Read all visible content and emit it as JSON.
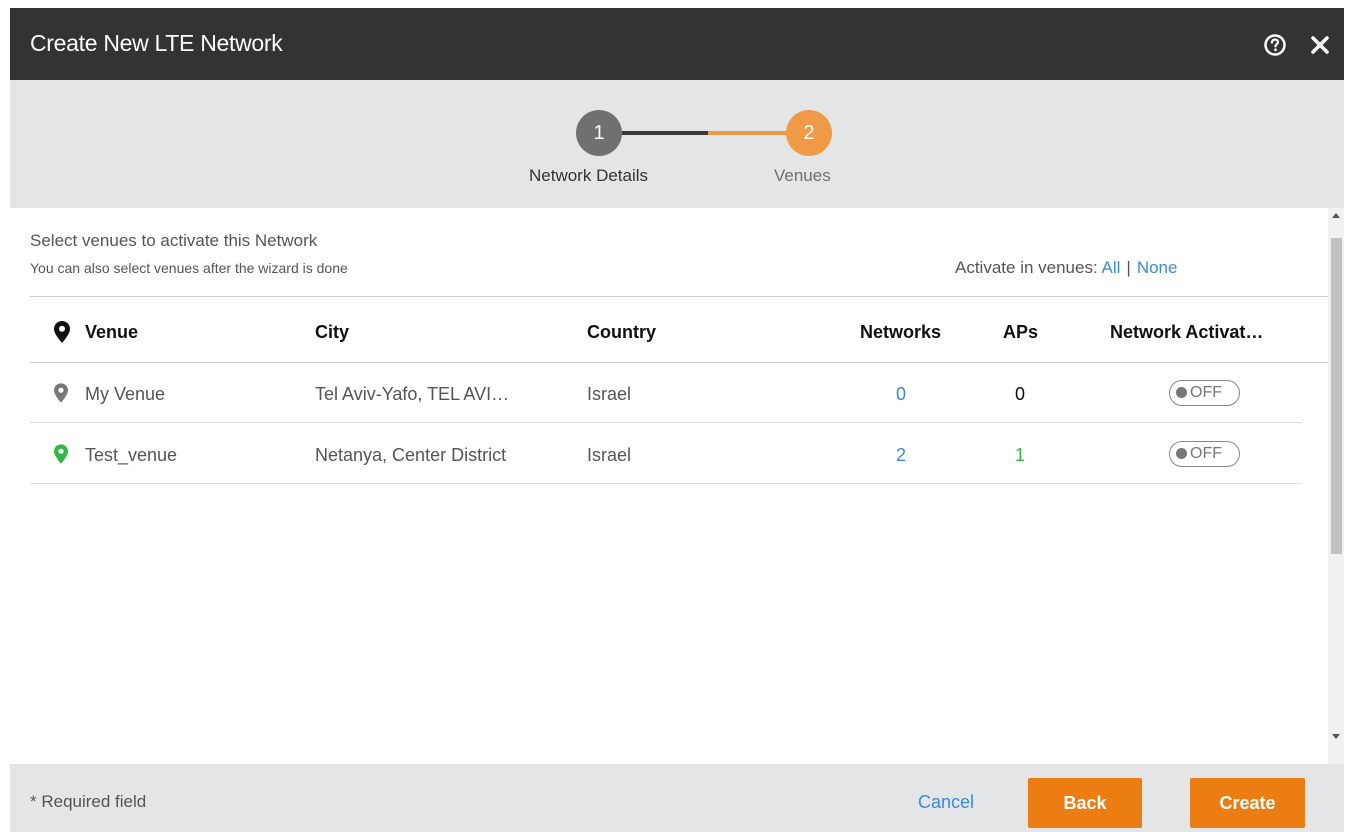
{
  "dialog": {
    "title": "Create New LTE Network"
  },
  "stepper": {
    "steps": [
      {
        "number": "1",
        "label": "Network Details",
        "state": "completed"
      },
      {
        "number": "2",
        "label": "Venues",
        "state": "active"
      }
    ]
  },
  "content": {
    "intro_title": "Select venues to activate this Network",
    "intro_subtitle": "You can also select venues after the wizard is done",
    "activate_label": "Activate in venues:",
    "activate_all": "All",
    "activate_separator": "|",
    "activate_none": "None"
  },
  "table": {
    "columns": {
      "venue": "Venue",
      "city": "City",
      "country": "Country",
      "networks": "Networks",
      "aps": "APs",
      "activation": "Network Activat…"
    },
    "rows": [
      {
        "venue": "My Venue",
        "city": "Tel Aviv-Yafo, TEL AVI…",
        "country": "Israel",
        "networks": "0",
        "aps": "0",
        "toggle": "OFF",
        "pin_color": "#777777"
      },
      {
        "venue": "Test_venue",
        "city": "Netanya, Center District",
        "country": "Israel",
        "networks": "2",
        "aps": "1",
        "toggle": "OFF",
        "pin_color": "#31b843"
      }
    ]
  },
  "footer": {
    "required_note": "* Required field",
    "cancel_label": "Cancel",
    "back_label": "Back",
    "create_label": "Create"
  },
  "colors": {
    "accent_orange": "#ec7d12",
    "step_active": "#ef9b45",
    "step_done": "#707070",
    "link_blue": "#3b8bd6",
    "titlebar": "#333333"
  },
  "icons": {
    "help": "help-circle-icon",
    "close": "close-icon",
    "venue_pin": "map-pin-icon"
  }
}
